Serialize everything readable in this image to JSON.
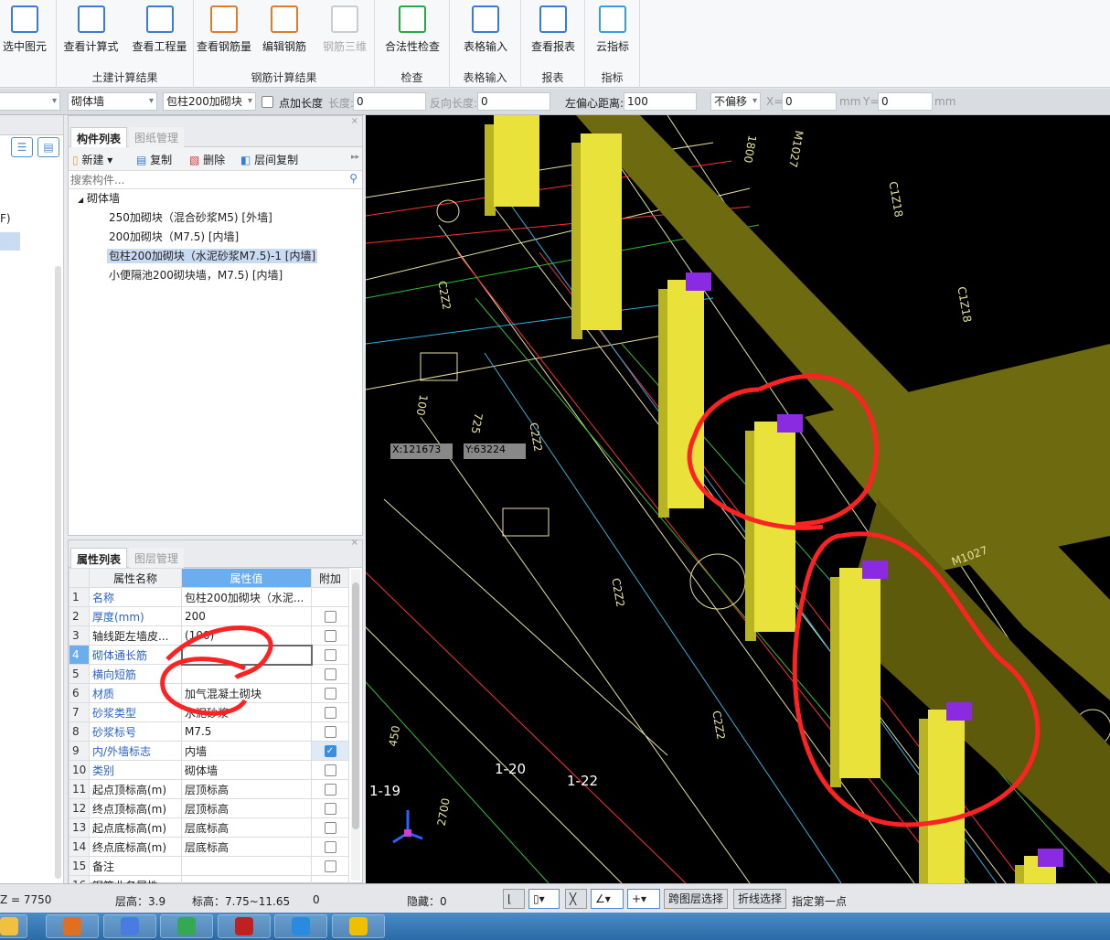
{
  "ribbon": {
    "groups": [
      {
        "label": "",
        "buttons": [
          {
            "label": "选中图元",
            "icon": "select-element-icon"
          }
        ]
      },
      {
        "label": "土建计算结果",
        "buttons": [
          {
            "label": "查看计算式",
            "icon": "view-formula-icon"
          },
          {
            "label": "查看工程量",
            "icon": "view-quantity-icon"
          }
        ]
      },
      {
        "label": "钢筋计算结果",
        "buttons": [
          {
            "label": "查看钢筋量",
            "icon": "view-rebar-icon"
          },
          {
            "label": "编辑钢筋",
            "icon": "edit-rebar-icon"
          },
          {
            "label": "钢筋三维",
            "icon": "rebar-3d-icon",
            "disabled": true
          }
        ]
      },
      {
        "label": "检查",
        "buttons": [
          {
            "label": "合法性检查",
            "icon": "check-icon"
          }
        ]
      },
      {
        "label": "表格输入",
        "buttons": [
          {
            "label": "表格输入",
            "icon": "table-input-icon"
          }
        ]
      },
      {
        "label": "报表",
        "buttons": [
          {
            "label": "查看报表",
            "icon": "report-icon"
          }
        ]
      },
      {
        "label": "指标",
        "buttons": [
          {
            "label": "云指标",
            "icon": "cloud-icon"
          }
        ]
      }
    ]
  },
  "toolbar": {
    "type_select": "砌体墙",
    "component_select": "包柱200加砌块",
    "point_length_label": "点加长度",
    "length_label": "长度:",
    "length_value": "0",
    "reverse_label": "反向长度:",
    "reverse_value": "0",
    "offset_label": "左偏心距离:",
    "offset_value": "100",
    "offset_mode": "不偏移",
    "x_label": "X=",
    "x_value": "0",
    "y_label": "Y=",
    "y_value": "0",
    "unit": "mm"
  },
  "nav": {
    "partial_item": "F)"
  },
  "component_panel": {
    "tabs": [
      "构件列表",
      "图纸管理"
    ],
    "actions": [
      "新建",
      "复制",
      "删除",
      "层间复制"
    ],
    "search_placeholder": "搜索构件...",
    "category": "砌体墙",
    "items": [
      "250加砌块（混合砂浆M5) [外墙]",
      "200加砌块（M7.5) [内墙]",
      "包柱200加砌块（水泥砂浆M7.5)-1 [内墙]",
      "小便隔池200砌块墙，M7.5) [内墙]"
    ],
    "selected_index": 2
  },
  "property_panel": {
    "tabs": [
      "属性列表",
      "图层管理"
    ],
    "headers": [
      "属性名称",
      "属性值",
      "附加"
    ],
    "rows": [
      {
        "n": "1",
        "name": "名称",
        "value": "包柱200加砌块（水泥...",
        "blue": true,
        "check": null
      },
      {
        "n": "2",
        "name": "厚度(mm)",
        "value": "200",
        "blue": true,
        "check": false
      },
      {
        "n": "3",
        "name": "轴线距左墙皮...",
        "value": "(100)",
        "blue": false,
        "check": false
      },
      {
        "n": "4",
        "name": "砌体通长筋",
        "value": "",
        "blue": true,
        "check": false,
        "editing": true
      },
      {
        "n": "5",
        "name": "横向短筋",
        "value": "",
        "blue": true,
        "check": false
      },
      {
        "n": "6",
        "name": "材质",
        "value": "加气混凝土砌块",
        "blue": true,
        "check": false
      },
      {
        "n": "7",
        "name": "砂浆类型",
        "value": "水泥砂浆",
        "blue": true,
        "check": false
      },
      {
        "n": "8",
        "name": "砂浆标号",
        "value": "M7.5",
        "blue": true,
        "check": false
      },
      {
        "n": "9",
        "name": "内/外墙标志",
        "value": "内墙",
        "blue": true,
        "check": true
      },
      {
        "n": "10",
        "name": "类别",
        "value": "砌体墙",
        "blue": true,
        "check": false
      },
      {
        "n": "11",
        "name": "起点顶标高(m)",
        "value": "层顶标高",
        "blue": false,
        "check": false
      },
      {
        "n": "12",
        "name": "终点顶标高(m)",
        "value": "层顶标高",
        "blue": false,
        "check": false
      },
      {
        "n": "13",
        "name": "起点底标高(m)",
        "value": "层底标高",
        "blue": false,
        "check": false
      },
      {
        "n": "14",
        "name": "终点底标高(m)",
        "value": "层底标高",
        "blue": false,
        "check": false
      },
      {
        "n": "15",
        "name": "备注",
        "value": "",
        "blue": false,
        "check": false
      },
      {
        "n": "16",
        "name": "钢筋业务属性",
        "value": "",
        "blue": false,
        "check": null
      }
    ]
  },
  "cad": {
    "coord_x": "X:121673",
    "coord_y": "Y:63224",
    "axis_labels": [
      "1-19",
      "1-20",
      "1-22"
    ],
    "texts": [
      "C2Z2",
      "C2Z2",
      "C2Z2",
      "C2Z2",
      "M1027",
      "M1027",
      "C1Z18",
      "C1Z18",
      "1800",
      "100",
      "725",
      "450",
      "2700"
    ],
    "colors": {
      "background": "#000000",
      "column": "#e8e23a",
      "wall": "#6e6a10",
      "annotation": "#ff2020"
    }
  },
  "status": {
    "z": "Z = 7750",
    "floor_height": "层高：3.9",
    "elevation": "标高：7.75~11.65",
    "zero": "0",
    "hidden": "隐藏：0",
    "cross_layer": "跨图层选择",
    "polyline": "折线选择",
    "prompt": "指定第一点"
  },
  "taskbar": {
    "apps": [
      "explorer",
      "media-player",
      "feishu",
      "chrome",
      "autocad",
      "app-t",
      "app-music"
    ]
  }
}
